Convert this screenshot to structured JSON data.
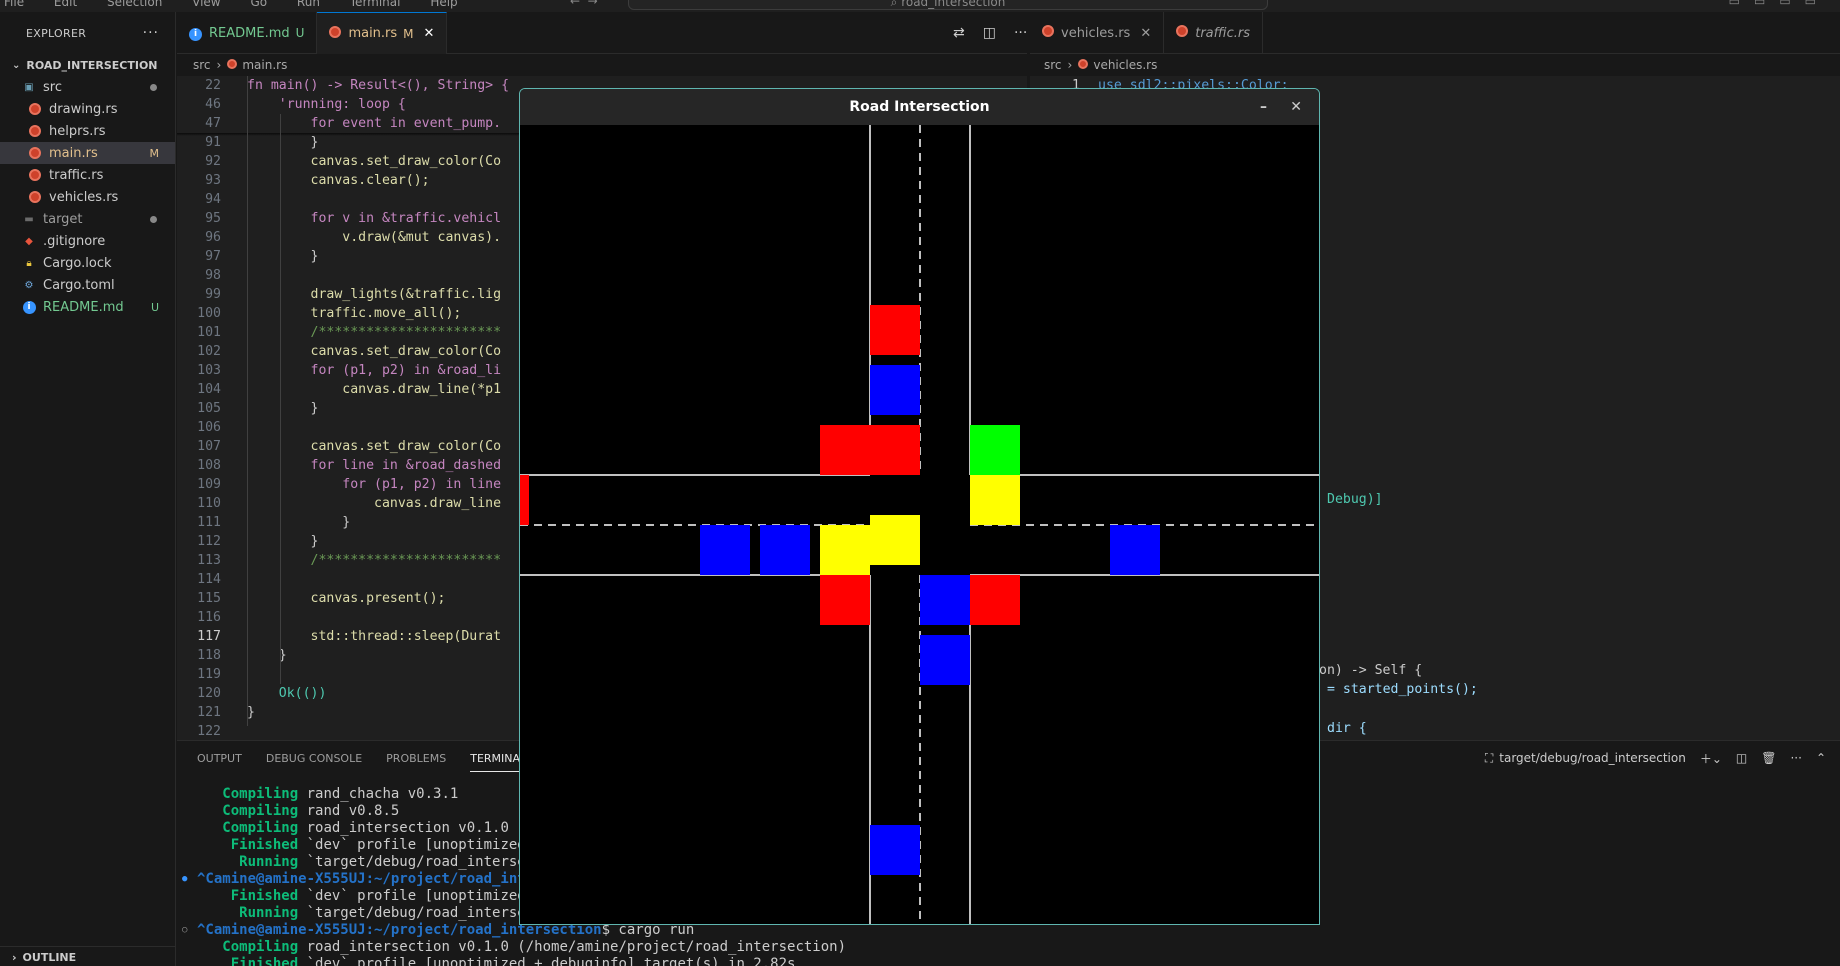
{
  "menubar": {
    "items": [
      "File",
      "Edit",
      "Selection",
      "View",
      "Go",
      "Run",
      "Terminal",
      "Help"
    ],
    "search": "road_intersection"
  },
  "explorer": {
    "title": "EXPLORER",
    "project": "ROAD_INTERSECTION",
    "items": [
      {
        "label": "src",
        "badge": ""
      },
      {
        "label": "drawing.rs",
        "badge": ""
      },
      {
        "label": "helprs.rs",
        "badge": ""
      },
      {
        "label": "main.rs",
        "badge": "M"
      },
      {
        "label": "traffic.rs",
        "badge": ""
      },
      {
        "label": "vehicles.rs",
        "badge": ""
      },
      {
        "label": "target",
        "badge": ""
      },
      {
        "label": ".gitignore",
        "badge": ""
      },
      {
        "label": "Cargo.lock",
        "badge": ""
      },
      {
        "label": "Cargo.toml",
        "badge": ""
      },
      {
        "label": "README.md",
        "badge": "U"
      }
    ],
    "outline": "OUTLINE"
  },
  "tabs_left": [
    {
      "label": "README.md",
      "status": "U"
    },
    {
      "label": "main.rs",
      "status": "M"
    }
  ],
  "tabs_right": [
    {
      "label": "vehicles.rs"
    },
    {
      "label": "traffic.rs"
    }
  ],
  "breadcrumb_left": {
    "folder": "src",
    "file": "main.rs"
  },
  "breadcrumb_right": {
    "folder": "src",
    "file": "vehicles.rs"
  },
  "code": [
    {
      "n": "22",
      "t": "fn main() -> Result<(), String> {"
    },
    {
      "n": "46",
      "t": "    'running: loop {"
    },
    {
      "n": "47",
      "t": "        for event in event_pump."
    },
    {
      "n": "91",
      "t": "        }"
    },
    {
      "n": "92",
      "t": "        canvas.set_draw_color(Co"
    },
    {
      "n": "93",
      "t": "        canvas.clear();"
    },
    {
      "n": "94",
      "t": ""
    },
    {
      "n": "95",
      "t": "        for v in &traffic.vehicl"
    },
    {
      "n": "96",
      "t": "            v.draw(&mut canvas)."
    },
    {
      "n": "97",
      "t": "        }"
    },
    {
      "n": "98",
      "t": ""
    },
    {
      "n": "99",
      "t": "        draw_lights(&traffic.lig"
    },
    {
      "n": "100",
      "t": "        traffic.move_all();"
    },
    {
      "n": "101",
      "t": "        /***********************"
    },
    {
      "n": "102",
      "t": "        canvas.set_draw_color(Co"
    },
    {
      "n": "103",
      "t": "        for (p1, p2) in &road_li"
    },
    {
      "n": "104",
      "t": "            canvas.draw_line(*p1"
    },
    {
      "n": "105",
      "t": "        }"
    },
    {
      "n": "106",
      "t": ""
    },
    {
      "n": "107",
      "t": "        canvas.set_draw_color(Co"
    },
    {
      "n": "108",
      "t": "        for line in &road_dashed"
    },
    {
      "n": "109",
      "t": "            for (p1, p2) in line"
    },
    {
      "n": "110",
      "t": "                canvas.draw_line"
    },
    {
      "n": "111",
      "t": "            }"
    },
    {
      "n": "112",
      "t": "        }"
    },
    {
      "n": "113",
      "t": "        /***********************"
    },
    {
      "n": "114",
      "t": ""
    },
    {
      "n": "115",
      "t": "        canvas.present();"
    },
    {
      "n": "116",
      "t": ""
    },
    {
      "n": "117",
      "t": "        std::thread::sleep(Durat"
    },
    {
      "n": "118",
      "t": "    }"
    },
    {
      "n": "119",
      "t": ""
    },
    {
      "n": "120",
      "t": "    Ok(())"
    },
    {
      "n": "121",
      "t": "}"
    },
    {
      "n": "122",
      "t": ""
    }
  ],
  "right_code": {
    "line1_num": "1",
    "line1": "use sdl2::pixels::Color;",
    "frag_debug": "Debug)]",
    "frag_self": "on) -> Self {",
    "frag_points": "= started_points();",
    "frag_dir": "dir {"
  },
  "panel": {
    "tabs": [
      "OUTPUT",
      "DEBUG CONSOLE",
      "PROBLEMS",
      "TERMINAL"
    ],
    "terminal_name": "target/debug/road_intersection",
    "lines": [
      {
        "k": "   Compiling",
        "p": " rand_chacha v0.3.1",
        "dot": ""
      },
      {
        "k": "   Compiling",
        "p": " rand v0.8.5",
        "dot": ""
      },
      {
        "k": "   Compiling",
        "p": " road_intersection v0.1.0 (/",
        "dot": ""
      },
      {
        "k": "    Finished",
        "p": " `dev` profile [unoptimized",
        "dot": ""
      },
      {
        "k": "     Running",
        "p": " `target/debug/road_intersec",
        "dot": ""
      },
      {
        "k": "",
        "prompt": "^Camine@amine-X555UJ:~/project/road_inte",
        "p": "",
        "dot": "●"
      },
      {
        "k": "    Finished",
        "p": " `dev` profile [unoptimized",
        "dot": ""
      },
      {
        "k": "     Running",
        "p": " `target/debug/road_intersec",
        "dot": ""
      },
      {
        "k": "",
        "prompt": "^Camine@amine-X555UJ:~/project/road_intersection",
        "p": "$ cargo run",
        "dot": "○"
      },
      {
        "k": "   Compiling",
        "p": " road_intersection v0.1.0 (/home/amine/project/road_intersection)",
        "dot": ""
      },
      {
        "k": "    Finished",
        "p": " `dev` profile [unoptimized + debuginfo] target(s) in 2.82s",
        "dot": ""
      }
    ]
  },
  "game": {
    "title": "Road Intersection",
    "minimize": "–",
    "close": "✕",
    "colors": {
      "red": "#ff0000",
      "blue": "#0000ff",
      "yellow": "#ffff00",
      "green": "#00ff00",
      "road_line": "#ffffff"
    },
    "vehicles": [
      {
        "color": "red",
        "col": 7,
        "row": 3.6
      },
      {
        "color": "blue",
        "col": 7,
        "row": 4.8
      },
      {
        "color": "blue",
        "col": 7,
        "row": 14.0
      },
      {
        "color": "blue",
        "col": 8,
        "row": 9.0
      },
      {
        "color": "blue",
        "col": 8,
        "row": 10.2
      },
      {
        "color": "blue",
        "col": 3.6,
        "row": 8
      },
      {
        "color": "blue",
        "col": 4.8,
        "row": 8
      },
      {
        "color": "blue",
        "col": 11.8,
        "row": 8
      },
      {
        "color": "yellow",
        "col": 6,
        "row": 8
      },
      {
        "color": "yellow",
        "col": 7,
        "row": 7.8
      },
      {
        "color": "red",
        "col": 0,
        "row": 7,
        "w": 0.18
      }
    ],
    "lights": [
      {
        "color": "red",
        "col": 6,
        "row": 6
      },
      {
        "color": "red",
        "col": 7,
        "row": 6
      },
      {
        "color": "green",
        "col": 9,
        "row": 6
      },
      {
        "color": "yellow",
        "col": 9,
        "row": 7
      },
      {
        "color": "red",
        "col": 6,
        "row": 9
      },
      {
        "color": "red",
        "col": 9,
        "row": 9
      }
    ]
  }
}
